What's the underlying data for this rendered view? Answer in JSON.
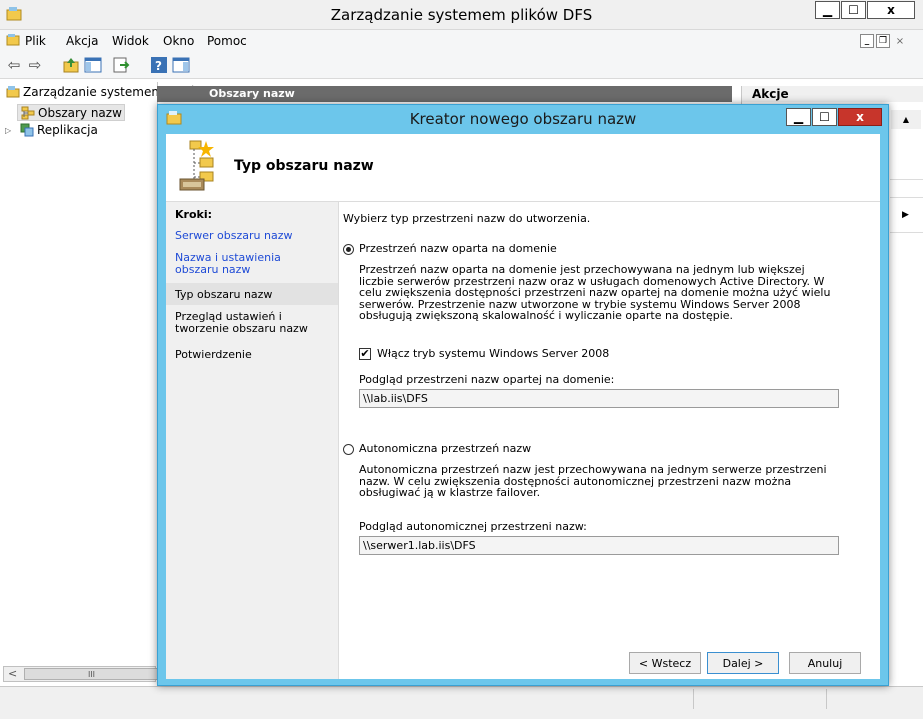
{
  "window": {
    "title": "Zarządzanie systemem plików DFS"
  },
  "menu": [
    "Plik",
    "Akcja",
    "Widok",
    "Okno",
    "Pomoc"
  ],
  "tree": {
    "root": "Zarządzanie systemem plików DFS",
    "items": [
      "Obszary nazw",
      "Replikacja"
    ]
  },
  "center": {
    "header": "Obszary nazw"
  },
  "actions": {
    "header": "Akcje"
  },
  "scrollbar": {
    "left_arrow": "<",
    "thumb": "III"
  },
  "dialog": {
    "title": "Kreator nowego obszaru nazw",
    "heading": "Typ obszaru nazw",
    "steps_label": "Kroki:",
    "steps": [
      {
        "label": "Serwer obszaru nazw",
        "state": "link"
      },
      {
        "label": "Nazwa i ustawienia obszaru nazw",
        "state": "link"
      },
      {
        "label": "Typ obszaru nazw",
        "state": "current"
      },
      {
        "label": "Przegląd ustawień i tworzenie obszaru nazw",
        "state": "pending"
      },
      {
        "label": "Potwierdzenie",
        "state": "pending"
      }
    ],
    "intro": "Wybierz typ przestrzeni nazw do utworzenia.",
    "option_domain": {
      "label": "Przestrzeń nazw oparta na domenie",
      "selected": true,
      "description": "Przestrzeń nazw oparta na domenie jest przechowywana na jednym lub większej liczbie serwerów przestrzeni nazw oraz w usługach domenowych Active Directory. W celu zwiększenia dostępności przestrzeni nazw opartej na domenie można użyć wielu serwerów. Przestrzenie nazw utworzone w trybie systemu Windows Server 2008 obsługują zwiększoną skalowalność i wyliczanie oparte na dostępie.",
      "checkbox_label": "Włącz tryb systemu Windows Server 2008",
      "checkbox_checked": true,
      "preview_label": "Podgląd przestrzeni nazw opartej na domenie:",
      "preview_value": "\\\\lab.iis\\DFS"
    },
    "option_standalone": {
      "label": "Autonomiczna przestrzeń nazw",
      "selected": false,
      "description": "Autonomiczna przestrzeń nazw jest przechowywana na jednym serwerze przestrzeni nazw. W celu zwiększenia dostępności autonomicznej przestrzeni nazw można obsługiwać ją w klastrze failover.",
      "preview_label": "Podgląd autonomicznej przestrzeni nazw:",
      "preview_value": "\\\\serwer1.lab.iis\\DFS"
    },
    "buttons": {
      "back": "< Wstecz",
      "next": "Dalej >",
      "cancel": "Anuluj"
    }
  },
  "colors": {
    "dialog_frame": "#6cc6eb",
    "link": "#1f4bd6",
    "close_red": "#c7352b"
  }
}
